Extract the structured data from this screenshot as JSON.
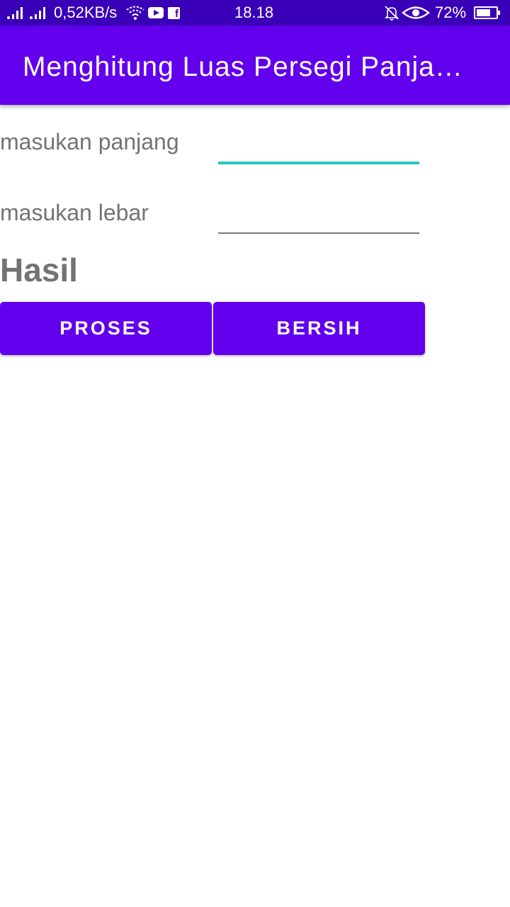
{
  "status_bar": {
    "network_speed": "0,52KB/s",
    "time": "18.18",
    "battery": "72%",
    "battery_level": 0.72,
    "icons": [
      "signal-icon",
      "wifi-icon",
      "youtube-icon",
      "facebook-icon",
      "mute-icon",
      "eye-icon",
      "battery-icon"
    ]
  },
  "app_bar": {
    "title": "Menghitung Luas Persegi Panja…"
  },
  "form": {
    "panjang_label": "masukan panjang",
    "panjang_value": "",
    "lebar_label": "masukan lebar",
    "lebar_value": ""
  },
  "result": {
    "text": "Hasil"
  },
  "buttons": {
    "proses": "PROSES",
    "bersih": "BERSIH"
  },
  "colors": {
    "primary": "#6200ee",
    "status_bar": "#3a00b8",
    "focus_accent": "#26c6c0",
    "text_gray": "#737373"
  }
}
